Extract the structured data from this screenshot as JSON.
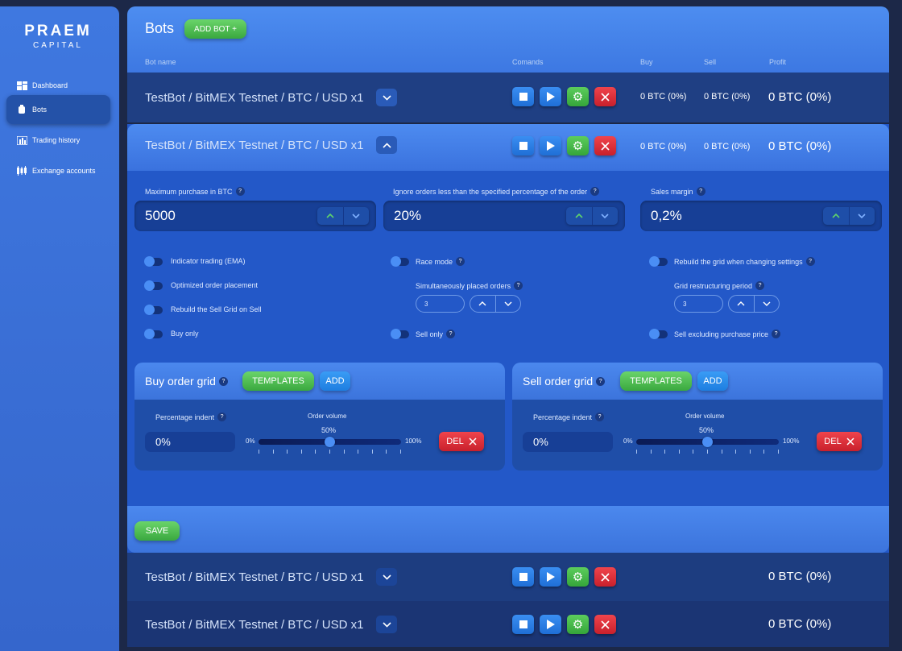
{
  "logo": {
    "line1": "PRAEM",
    "line2": "CAPITAL"
  },
  "sidebar": {
    "items": [
      {
        "label": "Dashboard",
        "icon": "dashboard-icon"
      },
      {
        "label": "Bots",
        "icon": "bot-icon"
      },
      {
        "label": "Trading history",
        "icon": "bar-chart-icon"
      },
      {
        "label": "Exchange accounts",
        "icon": "candlestick-icon"
      }
    ]
  },
  "header": {
    "title": "Bots",
    "add_label": "ADD BOT +",
    "columns": {
      "bot_name": "Bot name",
      "commands": "Comands",
      "buy": "Buy",
      "sell": "Sell",
      "profit": "Profit"
    }
  },
  "bots": [
    {
      "name": "TestBot / BitMEX Testnet / BTC / USD x1",
      "buy": "0 BTC (0%)",
      "sell": "0 BTC (0%)",
      "profit": "0 BTC (0%)"
    },
    {
      "name": "TestBot / BitMEX Testnet / BTC / USD x1",
      "buy": "0 BTC (0%)",
      "sell": "0 BTC (0%)",
      "profit": "0 BTC (0%)"
    },
    {
      "name": "TestBot / BitMEX Testnet / BTC / USD x1",
      "buy": "",
      "sell": "",
      "profit": "0 BTC (0%)"
    },
    {
      "name": "TestBot / BitMEX Testnet / BTC / USD x1",
      "buy": "",
      "sell": "",
      "profit": "0 BTC (0%)"
    }
  ],
  "settings": {
    "max_purchase": {
      "label": "Maximum purchase in BTC",
      "value": "5000"
    },
    "ignore_orders": {
      "label": "Ignore orders less than the specified percentage of the order",
      "value": "20%"
    },
    "sales_margin": {
      "label": "Sales margin",
      "value": "0,2%"
    },
    "toggles_left": [
      "Indicator trading (EMA)",
      "Optimized order placement",
      "Rebuild the Sell Grid on Sell",
      "Buy only"
    ],
    "race_mode": "Race mode",
    "simultaneous": {
      "label": "Simultaneously placed orders",
      "value": "3"
    },
    "sell_only": "Sell only",
    "rebuild_grid": "Rebuild the grid when changing settings",
    "restructuring": {
      "label": "Grid restructuring period",
      "value": "3"
    },
    "sell_excluding": "Sell excluding purchase price"
  },
  "buy_grid": {
    "title": "Buy order grid",
    "templates": "TEMPLATES",
    "add": "ADD",
    "pct_label": "Percentage indent",
    "pct_value": "0%",
    "volume_label": "Order volume",
    "volume_value": "50%",
    "volume_fraction": 0.5,
    "min": "0%",
    "max": "100%",
    "del": "DEL"
  },
  "sell_grid": {
    "title": "Sell order grid",
    "templates": "TEMPLATES",
    "add": "ADD",
    "pct_label": "Percentage indent",
    "pct_value": "0%",
    "volume_label": "Order volume",
    "volume_value": "50%",
    "volume_fraction": 0.5,
    "min": "0%",
    "max": "100%",
    "del": "DEL"
  },
  "save_label": "SAVE"
}
